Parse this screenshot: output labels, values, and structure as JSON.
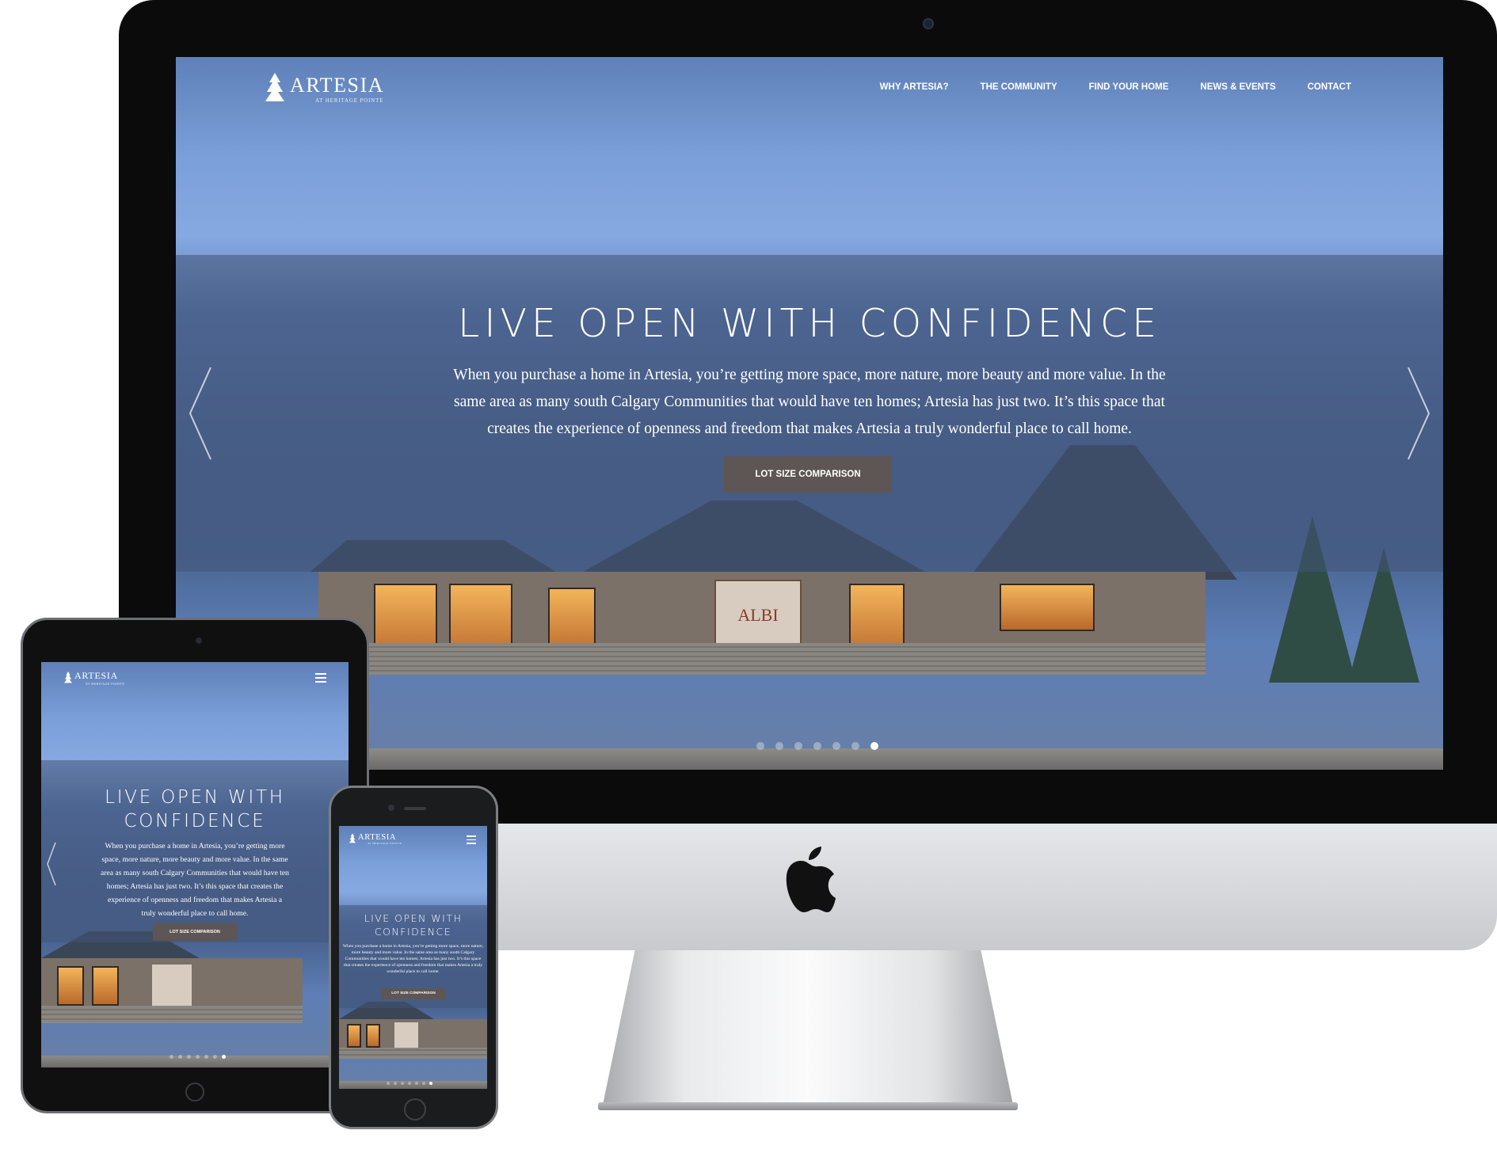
{
  "site": {
    "logo_name": "ARTESIA",
    "logo_tagline": "AT HERITAGE POINTE"
  },
  "nav": {
    "items": [
      {
        "label": "WHY ARTESIA?"
      },
      {
        "label": "THE COMMUNITY"
      },
      {
        "label": "FIND YOUR HOME"
      },
      {
        "label": "NEWS & EVENTS"
      },
      {
        "label": "CONTACT"
      }
    ]
  },
  "hero": {
    "title": "LIVE OPEN WITH CONFIDENCE",
    "title_line1": "LIVE OPEN WITH",
    "title_line2": "CONFIDENCE",
    "body": "When you purchase a home in Artesia, you’re getting more space, more nature, more beauty and more value. In the same area as many south Calgary Communities that would have ten homes; Artesia has just two. It’s this space that creates the experience of openness and freedom that makes Artesia a truly wonderful place to call home.",
    "cta_label": "LOT SIZE COMPARISON",
    "house_sign": "ALBI",
    "slides_total": 7,
    "active_slide": 7
  },
  "icons": {
    "prev": "chevron-left-icon",
    "next": "chevron-right-icon",
    "menu": "hamburger-menu-icon",
    "logo": "tree-logo-icon",
    "apple": "apple-logo-icon"
  },
  "colors": {
    "overlay": "#425476",
    "cta_bg": "#5e5654",
    "sky": "#87a9e2"
  }
}
